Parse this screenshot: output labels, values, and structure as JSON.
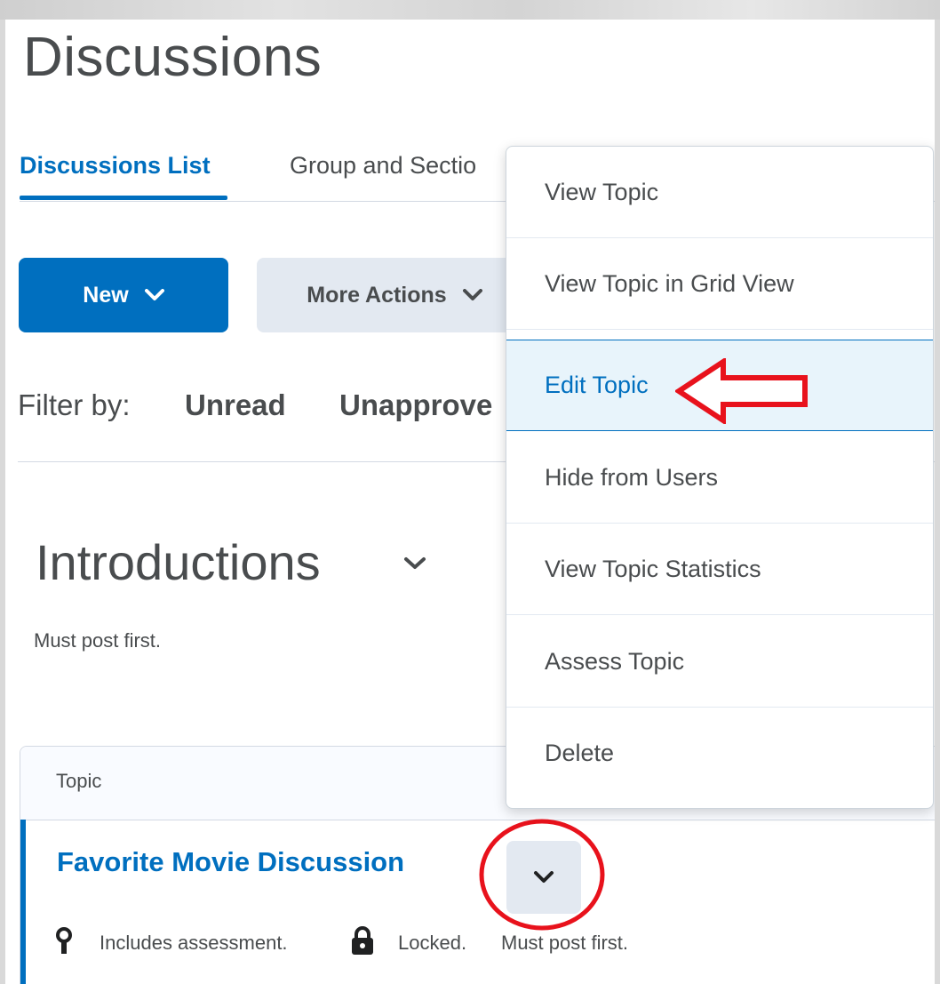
{
  "page": {
    "title": "Discussions"
  },
  "tabs": [
    {
      "label": "Discussions List",
      "active": true
    },
    {
      "label": "Group and Sectio"
    }
  ],
  "actions": {
    "new_label": "New",
    "more_label": "More Actions"
  },
  "filter": {
    "label": "Filter by:",
    "options": [
      "Unread",
      "Unapprove"
    ]
  },
  "forum": {
    "title": "Introductions",
    "description": "Must post first."
  },
  "table": {
    "header": "Topic",
    "topic": {
      "title": "Favorite Movie Discussion",
      "meta": [
        "Includes assessment.",
        "Locked.",
        "Must post first."
      ]
    }
  },
  "context_menu": {
    "items": [
      {
        "label": "View Topic"
      },
      {
        "label": "View Topic in Grid View"
      },
      {
        "label": "Edit Topic",
        "highlighted": true
      },
      {
        "label": "Hide from Users"
      },
      {
        "label": "View Topic Statistics"
      },
      {
        "label": "Assess Topic"
      },
      {
        "label": "Delete"
      }
    ]
  },
  "colors": {
    "brand_blue": "#006fbf",
    "annotation_red": "#e8121c",
    "text_gray": "#494c4e",
    "button_secondary": "#e3e9f1",
    "menu_selected": "#e8f4fb"
  },
  "icons": [
    "chevron-down-icon",
    "ribbon-icon",
    "lock-icon"
  ]
}
